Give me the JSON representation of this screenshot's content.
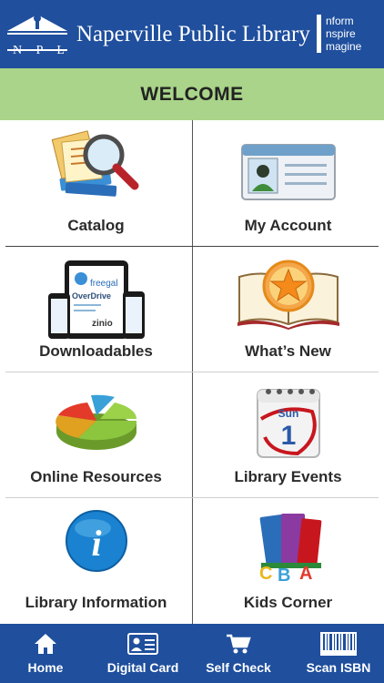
{
  "header": {
    "logo_text": "N P L",
    "title": "Naperville Public Library",
    "tagline": [
      "nform",
      "nspire",
      "magine"
    ]
  },
  "welcome": "WELCOME",
  "tiles": [
    {
      "label": "Catalog",
      "icon": "catalog-magnifier-books-icon"
    },
    {
      "label": "My Account",
      "icon": "account-id-card-icon"
    },
    {
      "label": "Downloadables",
      "icon": "devices-tablet-phone-icon"
    },
    {
      "label": "What’s New",
      "icon": "open-book-star-icon"
    },
    {
      "label": "Online Resources",
      "icon": "pie-chart-icon"
    },
    {
      "label": "Library Events",
      "icon": "calendar-icon"
    },
    {
      "label": "Library Information",
      "icon": "info-icon"
    },
    {
      "label": "Kids Corner",
      "icon": "kids-books-abc-icon"
    }
  ],
  "icon_text": {
    "downloadables_brands": [
      "freegal",
      "OverDrive",
      "zinio"
    ],
    "calendar_day": "Sun",
    "calendar_date": "1",
    "kids_letters": [
      "A",
      "B",
      "C"
    ],
    "info_glyph": "i"
  },
  "nav": [
    {
      "label": "Home",
      "icon": "home-icon"
    },
    {
      "label": "Digital Card",
      "icon": "digital-card-icon"
    },
    {
      "label": "Self Check",
      "icon": "cart-icon"
    },
    {
      "label": "Scan ISBN",
      "icon": "barcode-icon"
    }
  ],
  "colors": {
    "header_blue": "#1f4f9d",
    "welcome_green": "#a9d489"
  }
}
